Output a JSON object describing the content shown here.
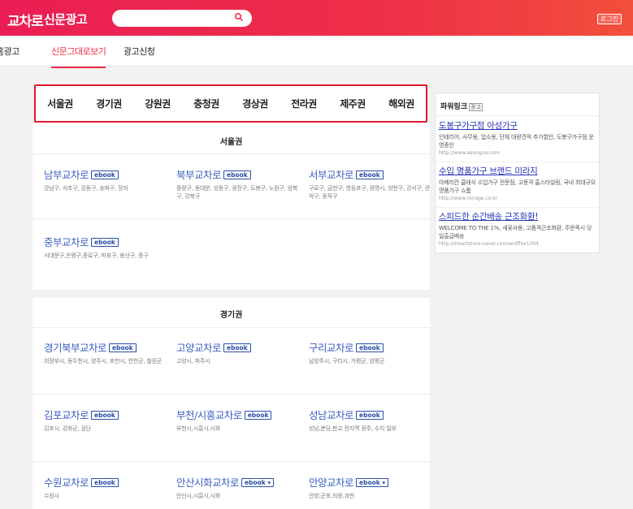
{
  "header": {
    "logo": "교차로",
    "subtitle": "신문광고",
    "search_placeholder": "",
    "login_label": "로그인"
  },
  "subnav": {
    "items": [
      "홈광고",
      "신문그대로보기",
      "광고신청"
    ]
  },
  "region_tabs": [
    "서울권",
    "경기권",
    "강원권",
    "충청권",
    "경상권",
    "전라권",
    "제주권",
    "해외권"
  ],
  "sections": {
    "seoul": {
      "title": "서울권",
      "papers": [
        {
          "name": "남부교차로",
          "badge": "ebook",
          "areas": "강남구, 서초구, 강동구, 송파구, 장지"
        },
        {
          "name": "북부교차로",
          "badge": "ebook",
          "areas": "중랑구, 동대문, 성동구, 광진구, 도봉구, 노원구, 성북구, 강북구"
        },
        {
          "name": "서부교차로",
          "badge": "ebook",
          "areas": "구로구, 금천구, 영등포구, 광명시, 양천구, 강서구, 관악구, 동작구"
        },
        {
          "name": "중부교차로",
          "badge": "ebook",
          "areas": "서대문구,은평구,종로구, 마포구, 용산구, 중구"
        }
      ]
    },
    "gyeonggi": {
      "title": "경기권",
      "papers": [
        {
          "name": "경기북부교차로",
          "badge": "ebook",
          "areas": "의정부시, 동두천시, 양주시, 포천시, 연천군, 철원군"
        },
        {
          "name": "고양교차로",
          "badge": "ebook",
          "areas": "고양시, 파주시"
        },
        {
          "name": "구리교차로",
          "badge": "ebook",
          "areas": "남양주시, 구리시, 가평군, 양평군"
        },
        {
          "name": "김포교차로",
          "badge": "ebook",
          "areas": "김포시, 강화군, 검단"
        },
        {
          "name": "부천/시흥교차로",
          "badge": "ebook",
          "areas": "부천시,시흥시,시화"
        },
        {
          "name": "성남교차로",
          "badge": "ebook",
          "areas": "성남,분당,판교 전지역 광주, 수지 일부"
        },
        {
          "name": "수원교차로",
          "badge": "ebook",
          "areas": "수원시"
        },
        {
          "name": "안산시화교차로",
          "badge": "ebook ▾",
          "areas": "안산시,시흥시,시화"
        },
        {
          "name": "안양교차로",
          "badge": "ebook ▾",
          "areas": "안양,군포,의왕,과천"
        }
      ]
    }
  },
  "powerlink": {
    "title": "파워링크",
    "badge": "광고",
    "ads": [
      {
        "title": "도봉구가구점 아성가구",
        "desc": "인테리어, 사무용, 업소용, 단체 대량견적 추가할인, 도봉구가구점 운영중인",
        "url": "http://www.asungoa.com"
      },
      {
        "title": "수입 명품가구 브랜드 미라지",
        "desc": "아메리칸 클래식 수입가구 전문점, 고풍격 홈스타일링, 국내 최대규모 명품가구 쇼룸",
        "url": "http://www.mirage.co.kr"
      },
      {
        "title": "스피드한 순간배송 근조화환!",
        "desc": "WELCOME TO THE 1%, 새꽃사용, 고품격근조화환, 주문즉시 당일출급배송",
        "url": "http://smartstore.naver.com/wolffox1004"
      }
    ]
  },
  "colors": {
    "brand": "#ee2f48",
    "link": "#3b5fbf",
    "ebook": "#2a4fa8"
  }
}
